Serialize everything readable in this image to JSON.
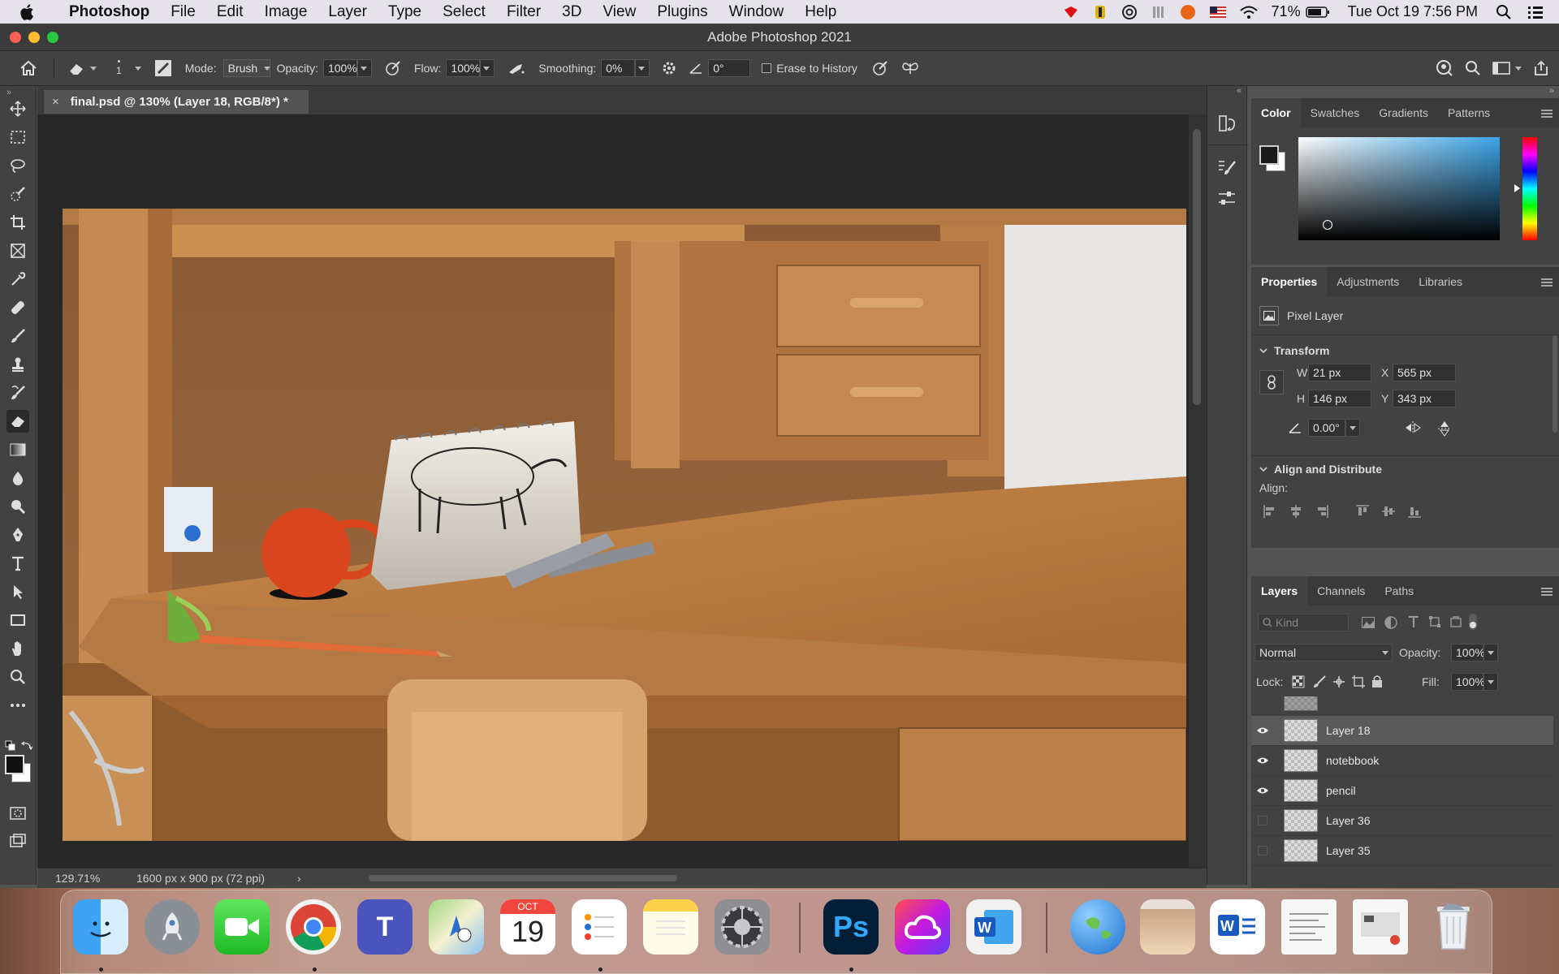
{
  "menubar": {
    "app_name": "Photoshop",
    "items": [
      "File",
      "Edit",
      "Image",
      "Layer",
      "Type",
      "Select",
      "Filter",
      "3D",
      "View",
      "Plugins",
      "Window",
      "Help"
    ],
    "battery": "71%",
    "clock": "Tue Oct 19  7:56 PM"
  },
  "window": {
    "title": "Adobe Photoshop 2021"
  },
  "options": {
    "brush_size": "1",
    "mode_label": "Mode:",
    "mode_value": "Brush",
    "opacity_label": "Opacity:",
    "opacity_value": "100%",
    "flow_label": "Flow:",
    "flow_value": "100%",
    "smoothing_label": "Smoothing:",
    "smoothing_value": "0%",
    "angle_value": "0°",
    "erase_history_label": "Erase to History"
  },
  "tools": [
    "move-icon",
    "marquee-icon",
    "lasso-icon",
    "quick-select-icon",
    "crop-icon",
    "frame-icon",
    "eyedropper-icon",
    "healing-icon",
    "brush-icon",
    "stamp-icon",
    "history-brush-icon",
    "eraser-icon",
    "gradient-icon",
    "blur-icon",
    "dodge-icon",
    "pen-icon",
    "type-icon",
    "path-select-icon",
    "rectangle-icon",
    "hand-icon",
    "zoom-icon",
    "more-icon"
  ],
  "document": {
    "tab_title": "final.psd @ 130% (Layer 18, RGB/8*) *",
    "zoom": "129.71%",
    "info": "1600 px x 900 px (72 ppi)"
  },
  "color_panel": {
    "tabs": [
      "Color",
      "Swatches",
      "Gradients",
      "Patterns"
    ],
    "active": "Color",
    "foreground": "#1b1b1b",
    "background": "#ffffff"
  },
  "properties_panel": {
    "tabs": [
      "Properties",
      "Adjustments",
      "Libraries"
    ],
    "active": "Properties",
    "type_label": "Pixel Layer",
    "transform_title": "Transform",
    "w_label": "W",
    "w_value": "21 px",
    "x_label": "X",
    "x_value": "565 px",
    "h_label": "H",
    "h_value": "146 px",
    "y_label": "Y",
    "y_value": "343 px",
    "angle_value": "0.00°",
    "align_title": "Align and Distribute",
    "align_label": "Align:"
  },
  "layers_panel": {
    "tabs": [
      "Layers",
      "Channels",
      "Paths"
    ],
    "active": "Layers",
    "kind_placeholder": "Kind",
    "blend_mode": "Normal",
    "opacity_label": "Opacity:",
    "opacity_value": "100%",
    "lock_label": "Lock:",
    "fill_label": "Fill:",
    "fill_value": "100%",
    "layers": [
      {
        "name": "Layer 18",
        "visible": true,
        "selected": true
      },
      {
        "name": "notebbook",
        "visible": true,
        "selected": false
      },
      {
        "name": "pencil",
        "visible": true,
        "selected": false
      },
      {
        "name": "Layer 36",
        "visible": false,
        "selected": false
      },
      {
        "name": "Layer 35",
        "visible": false,
        "selected": false
      }
    ]
  },
  "dock": {
    "apps": [
      "Finder",
      "Launchpad",
      "FaceTime",
      "Chrome",
      "Teams",
      "Maps",
      "Calendar",
      "Reminders",
      "Notes",
      "System Preferences",
      "Photoshop",
      "Creative Cloud",
      "Word",
      "Network",
      "Preview",
      "Word Document",
      "Document",
      "Screenshot",
      "Trash"
    ],
    "calendar_month": "OCT",
    "calendar_day": "19"
  }
}
